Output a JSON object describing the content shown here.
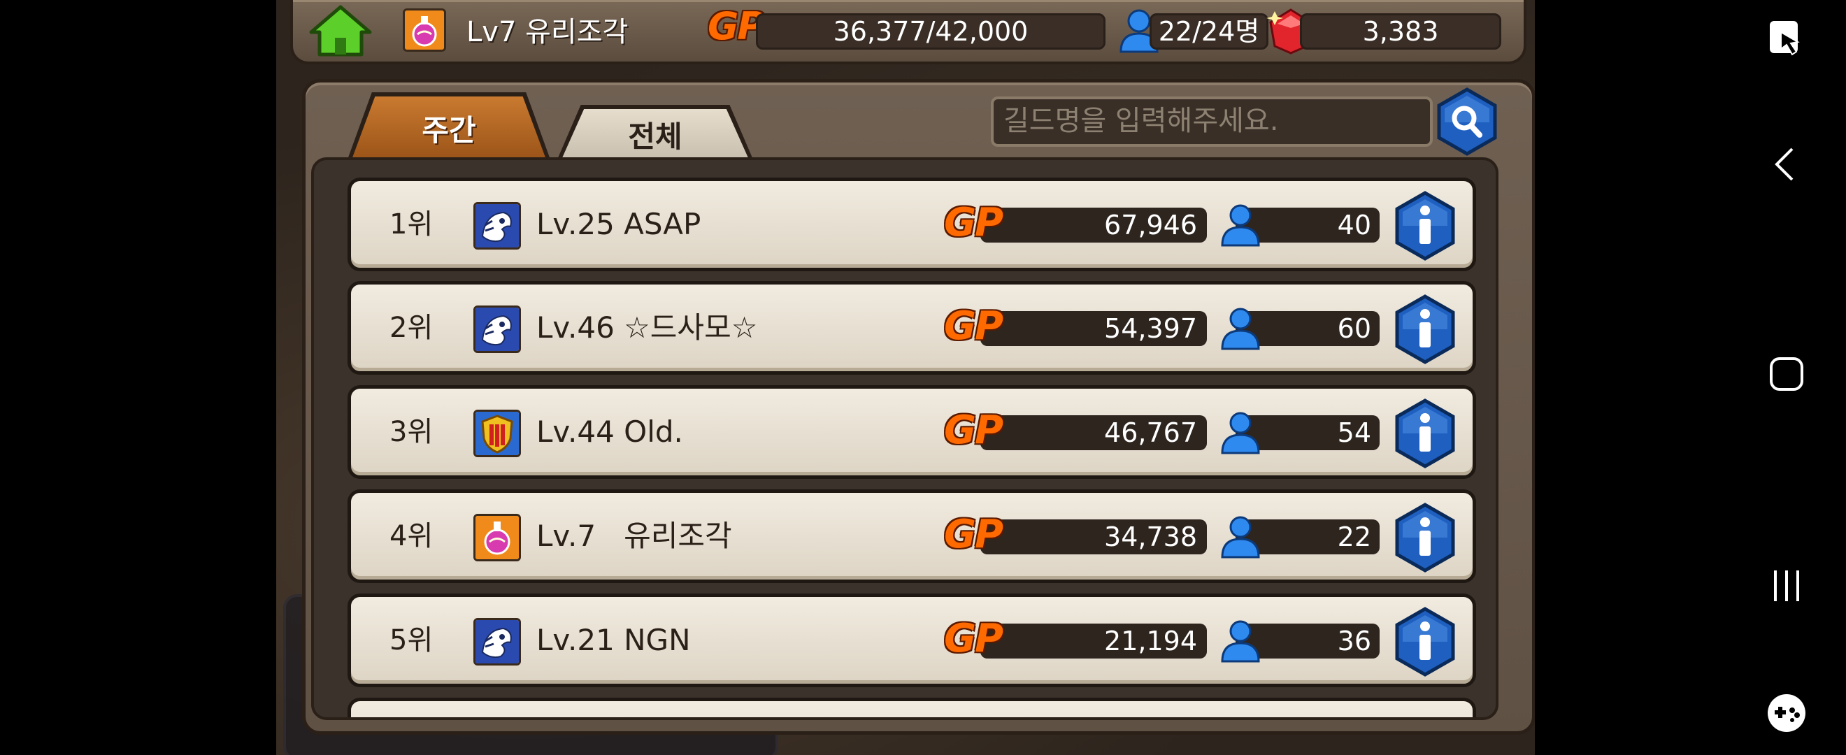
{
  "topbar": {
    "guild_title": "Lv7 유리조각",
    "gp_label": "GP",
    "gp_value": "36,377/42,000",
    "members_value": "22/24명",
    "gems_value": "3,383"
  },
  "tabs": [
    {
      "label": "주간",
      "active": true
    },
    {
      "label": "전체",
      "active": false
    }
  ],
  "search": {
    "placeholder": "길드명을 입력해주세요."
  },
  "rows": [
    {
      "rank": "1위",
      "name": "Lv.25 ASAP",
      "gp": "67,946",
      "members": "40",
      "emblem": "dragon-emblem"
    },
    {
      "rank": "2위",
      "name": "Lv.46 ☆드사모☆",
      "gp": "54,397",
      "members": "60",
      "emblem": "dragon-emblem"
    },
    {
      "rank": "3위",
      "name": "Lv.44 Old.",
      "gp": "46,767",
      "members": "54",
      "emblem": "shield-emblem"
    },
    {
      "rank": "4위",
      "name": "Lv.7   유리조각",
      "gp": "34,738",
      "members": "22",
      "emblem": "potion-emblem"
    },
    {
      "rank": "5위",
      "name": "Lv.21 NGN",
      "gp": "21,194",
      "members": "36",
      "emblem": "dragon-emblem"
    }
  ],
  "gp_badge": "GP",
  "colors": {
    "panel": "#6f6052",
    "row": "#f1ebe0",
    "gp_orange": "#ff6a00",
    "info_blue": "#1e5fc0",
    "tab_active": "#c97a30"
  }
}
